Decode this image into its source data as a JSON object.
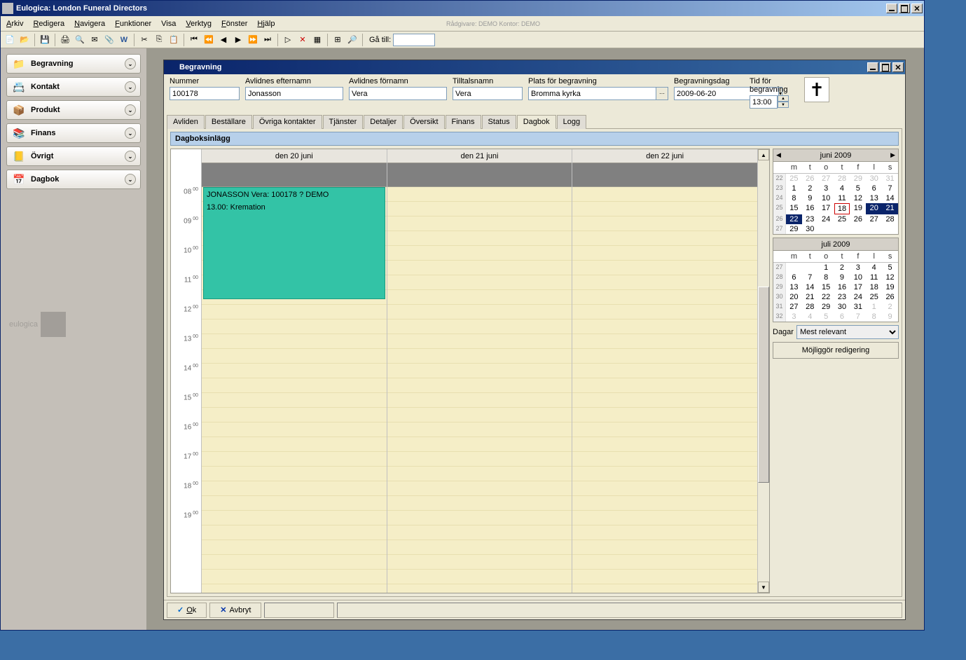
{
  "app": {
    "title": "Eulogica: London Funeral Directors",
    "status_hint": "Rådgivare: DEMO   Kontor: DEMO"
  },
  "menu": {
    "arkiv": "Arkiv",
    "redigera": "Redigera",
    "navigera": "Navigera",
    "funktioner": "Funktioner",
    "visa": "Visa",
    "verktyg": "Verktyg",
    "fonster": "Fönster",
    "hjalp": "Hjälp"
  },
  "toolbar": {
    "ga_till": "Gå till:",
    "ga_till_value": ""
  },
  "sidebar": {
    "items": [
      {
        "label": "Begravning"
      },
      {
        "label": "Kontakt"
      },
      {
        "label": "Produkt"
      },
      {
        "label": "Finans"
      },
      {
        "label": "Övrigt"
      },
      {
        "label": "Dagbok"
      }
    ],
    "logo": "eulogica"
  },
  "subwindow": {
    "title": "Begravning"
  },
  "form": {
    "nummer": {
      "label": "Nummer",
      "value": "100178"
    },
    "efternamn": {
      "label": "Avlidnes efternamn",
      "value": "Jonasson"
    },
    "fornamn": {
      "label": "Avlidnes förnamn",
      "value": "Vera"
    },
    "tilltal": {
      "label": "Tilltalsnamn",
      "value": "Vera"
    },
    "plats": {
      "label": "Plats för begravning",
      "value": "Bromma kyrka"
    },
    "dag": {
      "label": "Begravningsdag",
      "value": "2009-06-20"
    },
    "tid": {
      "label": "Tid för begravning",
      "value": "13:00"
    }
  },
  "tabs": {
    "avliden": "Avliden",
    "bestallare": "Beställare",
    "ovriga": "Övriga kontakter",
    "tjanster": "Tjänster",
    "detaljer": "Detaljer",
    "oversikt": "Översikt",
    "finans": "Finans",
    "status": "Status",
    "dagbok": "Dagbok",
    "logg": "Logg"
  },
  "diary": {
    "section_title": "Dagboksinlägg",
    "day_headers": [
      "den 20 juni",
      "den 21 juni",
      "den 22 juni"
    ],
    "hours": [
      "08",
      "09",
      "10",
      "11",
      "12",
      "13",
      "14",
      "15",
      "16",
      "17",
      "18",
      "19"
    ],
    "appointment": {
      "line1": "JONASSON Vera:   100178 ? DEMO",
      "line2": "13.00: Kremation"
    }
  },
  "minical": {
    "month1": {
      "title": "juni 2009",
      "dow": [
        "m",
        "t",
        "o",
        "t",
        "f",
        "l",
        "s"
      ],
      "weeks": [
        {
          "wk": "22",
          "days": [
            {
              "d": "25",
              "o": true
            },
            {
              "d": "26",
              "o": true
            },
            {
              "d": "27",
              "o": true
            },
            {
              "d": "28",
              "o": true
            },
            {
              "d": "29",
              "o": true
            },
            {
              "d": "30",
              "o": true
            },
            {
              "d": "31",
              "o": true
            }
          ]
        },
        {
          "wk": "23",
          "days": [
            {
              "d": "1"
            },
            {
              "d": "2"
            },
            {
              "d": "3"
            },
            {
              "d": "4"
            },
            {
              "d": "5"
            },
            {
              "d": "6"
            },
            {
              "d": "7"
            }
          ]
        },
        {
          "wk": "24",
          "days": [
            {
              "d": "8"
            },
            {
              "d": "9"
            },
            {
              "d": "10"
            },
            {
              "d": "11"
            },
            {
              "d": "12"
            },
            {
              "d": "13"
            },
            {
              "d": "14"
            }
          ]
        },
        {
          "wk": "25",
          "days": [
            {
              "d": "15"
            },
            {
              "d": "16"
            },
            {
              "d": "17"
            },
            {
              "d": "18",
              "today": true
            },
            {
              "d": "19"
            },
            {
              "d": "20",
              "sel": true
            },
            {
              "d": "21",
              "sel": true
            }
          ]
        },
        {
          "wk": "26",
          "days": [
            {
              "d": "22",
              "sel": true
            },
            {
              "d": "23"
            },
            {
              "d": "24"
            },
            {
              "d": "25"
            },
            {
              "d": "26"
            },
            {
              "d": "27"
            },
            {
              "d": "28"
            }
          ]
        },
        {
          "wk": "27",
          "days": [
            {
              "d": "29"
            },
            {
              "d": "30"
            },
            {
              "d": ""
            },
            {
              "d": ""
            },
            {
              "d": ""
            },
            {
              "d": ""
            },
            {
              "d": ""
            }
          ]
        }
      ]
    },
    "month2": {
      "title": "juli 2009",
      "dow": [
        "m",
        "t",
        "o",
        "t",
        "f",
        "l",
        "s"
      ],
      "weeks": [
        {
          "wk": "27",
          "days": [
            {
              "d": ""
            },
            {
              "d": ""
            },
            {
              "d": "1"
            },
            {
              "d": "2"
            },
            {
              "d": "3"
            },
            {
              "d": "4"
            },
            {
              "d": "5"
            }
          ]
        },
        {
          "wk": "28",
          "days": [
            {
              "d": "6"
            },
            {
              "d": "7"
            },
            {
              "d": "8"
            },
            {
              "d": "9"
            },
            {
              "d": "10"
            },
            {
              "d": "11"
            },
            {
              "d": "12"
            }
          ]
        },
        {
          "wk": "29",
          "days": [
            {
              "d": "13"
            },
            {
              "d": "14"
            },
            {
              "d": "15"
            },
            {
              "d": "16"
            },
            {
              "d": "17"
            },
            {
              "d": "18"
            },
            {
              "d": "19"
            }
          ]
        },
        {
          "wk": "30",
          "days": [
            {
              "d": "20"
            },
            {
              "d": "21"
            },
            {
              "d": "22"
            },
            {
              "d": "23"
            },
            {
              "d": "24"
            },
            {
              "d": "25"
            },
            {
              "d": "26"
            }
          ]
        },
        {
          "wk": "31",
          "days": [
            {
              "d": "27"
            },
            {
              "d": "28"
            },
            {
              "d": "29"
            },
            {
              "d": "30"
            },
            {
              "d": "31"
            },
            {
              "d": "1",
              "o": true
            },
            {
              "d": "2",
              "o": true
            }
          ]
        },
        {
          "wk": "32",
          "days": [
            {
              "d": "3",
              "o": true
            },
            {
              "d": "4",
              "o": true
            },
            {
              "d": "5",
              "o": true
            },
            {
              "d": "6",
              "o": true
            },
            {
              "d": "7",
              "o": true
            },
            {
              "d": "8",
              "o": true
            },
            {
              "d": "9",
              "o": true
            }
          ]
        }
      ]
    },
    "dagar_label": "Dagar",
    "dagar_value": "Mest relevant",
    "enable_edit": "Möjliggör redigering"
  },
  "buttons": {
    "ok": "Ok",
    "avbryt": "Avbryt"
  }
}
